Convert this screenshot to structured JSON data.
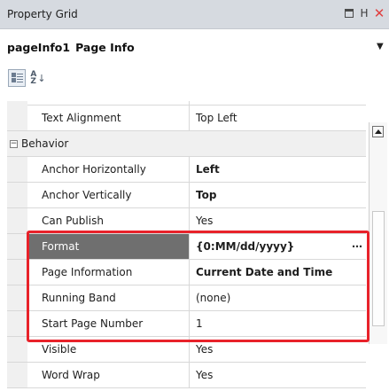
{
  "window": {
    "title": "Property Grid"
  },
  "object_selector": {
    "name": "pageInfo1",
    "type": "Page Info"
  },
  "toolbar": {
    "categorized_icon": "categorized-icon",
    "alphabetical_icon": "sort-az-icon"
  },
  "properties": [
    {
      "name": "Text Alignment",
      "value": "Top Left"
    },
    {
      "category": "Behavior"
    },
    {
      "name": "Anchor Horizontally",
      "value": "Left",
      "bold": true
    },
    {
      "name": "Anchor Vertically",
      "value": "Top",
      "bold": true
    },
    {
      "name": "Can Publish",
      "value": "Yes"
    },
    {
      "name": "Format",
      "value": "{0:MM/dd/yyyy}",
      "selected": true
    },
    {
      "name": "Page Information",
      "value": "Current Date and Time",
      "bold": true
    },
    {
      "name": "Running Band",
      "value": "(none)"
    },
    {
      "name": "Start Page Number",
      "value": "1"
    },
    {
      "name": "Visible",
      "value": "Yes"
    },
    {
      "name": "Word Wrap",
      "value": "Yes"
    }
  ],
  "colors": {
    "highlight": "#e8222a",
    "selected_row": "#6f6f6f",
    "title_bar": "#d6dae0"
  }
}
